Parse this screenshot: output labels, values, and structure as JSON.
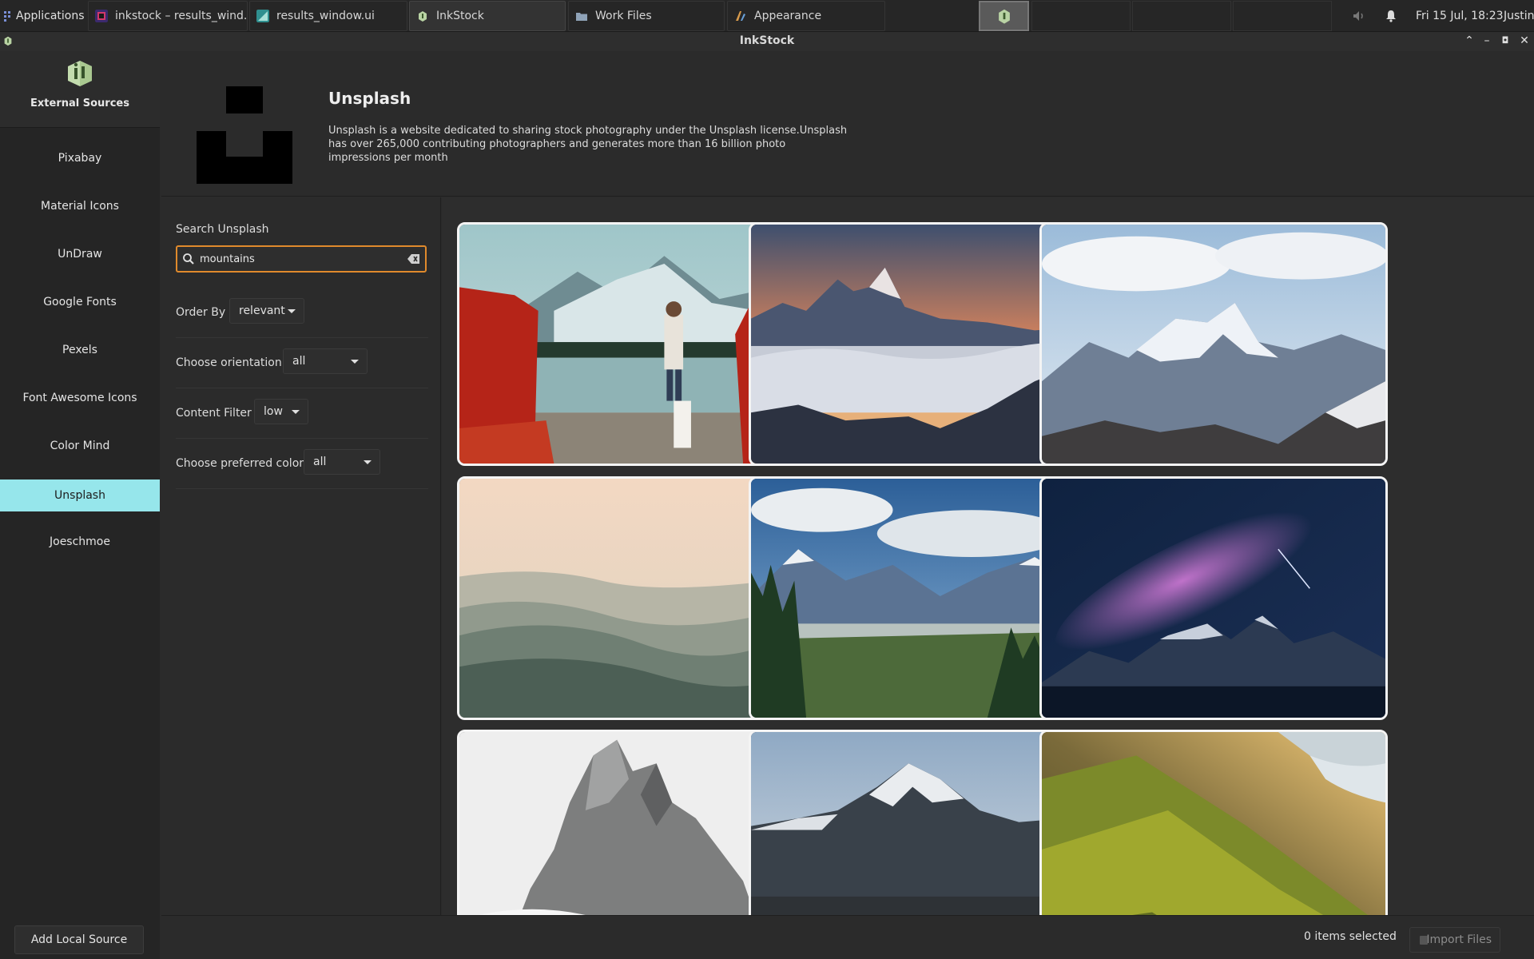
{
  "panel": {
    "apps_label": "Applications",
    "tasks": [
      {
        "label": "inkstock – results_wind..."
      },
      {
        "label": "results_window.ui"
      },
      {
        "label": "InkStock"
      },
      {
        "label": "Work Files"
      },
      {
        "label": "Appearance"
      }
    ],
    "clock": "Fri 15 Jul, 18:23",
    "user": "Justin"
  },
  "window": {
    "title": "InkStock"
  },
  "sidebar": {
    "header_label": "External Sources",
    "items": [
      {
        "label": "Pixabay"
      },
      {
        "label": "Material Icons"
      },
      {
        "label": "UnDraw"
      },
      {
        "label": "Google Fonts"
      },
      {
        "label": "Pexels"
      },
      {
        "label": "Font Awesome Icons"
      },
      {
        "label": "Color Mind"
      },
      {
        "label": "Unsplash",
        "selected": true
      },
      {
        "label": "Joeschmoe"
      }
    ],
    "add_button": "Add Local Source"
  },
  "source": {
    "title": "Unsplash",
    "description": "Unsplash is a website dedicated to sharing stock photography under the Unsplash license.Unsplash has over 265,000 contributing photographers and generates more than 16 billion photo impressions per month"
  },
  "filters": {
    "search_label": "Search Unsplash",
    "search_value": "mountains",
    "order_by": {
      "label": "Order By",
      "value": "relevant"
    },
    "orientation": {
      "label": "Choose orientation",
      "value": "all"
    },
    "content_filter": {
      "label": "Content Filter",
      "value": "low"
    },
    "preferred_color": {
      "label": "Choose preferred color",
      "value": "all"
    }
  },
  "status": {
    "selected_text": "0 items selected",
    "import_label": "Import Files"
  },
  "colors": {
    "accent_selected": "#96e6eb",
    "search_focus": "#e08a2c"
  }
}
